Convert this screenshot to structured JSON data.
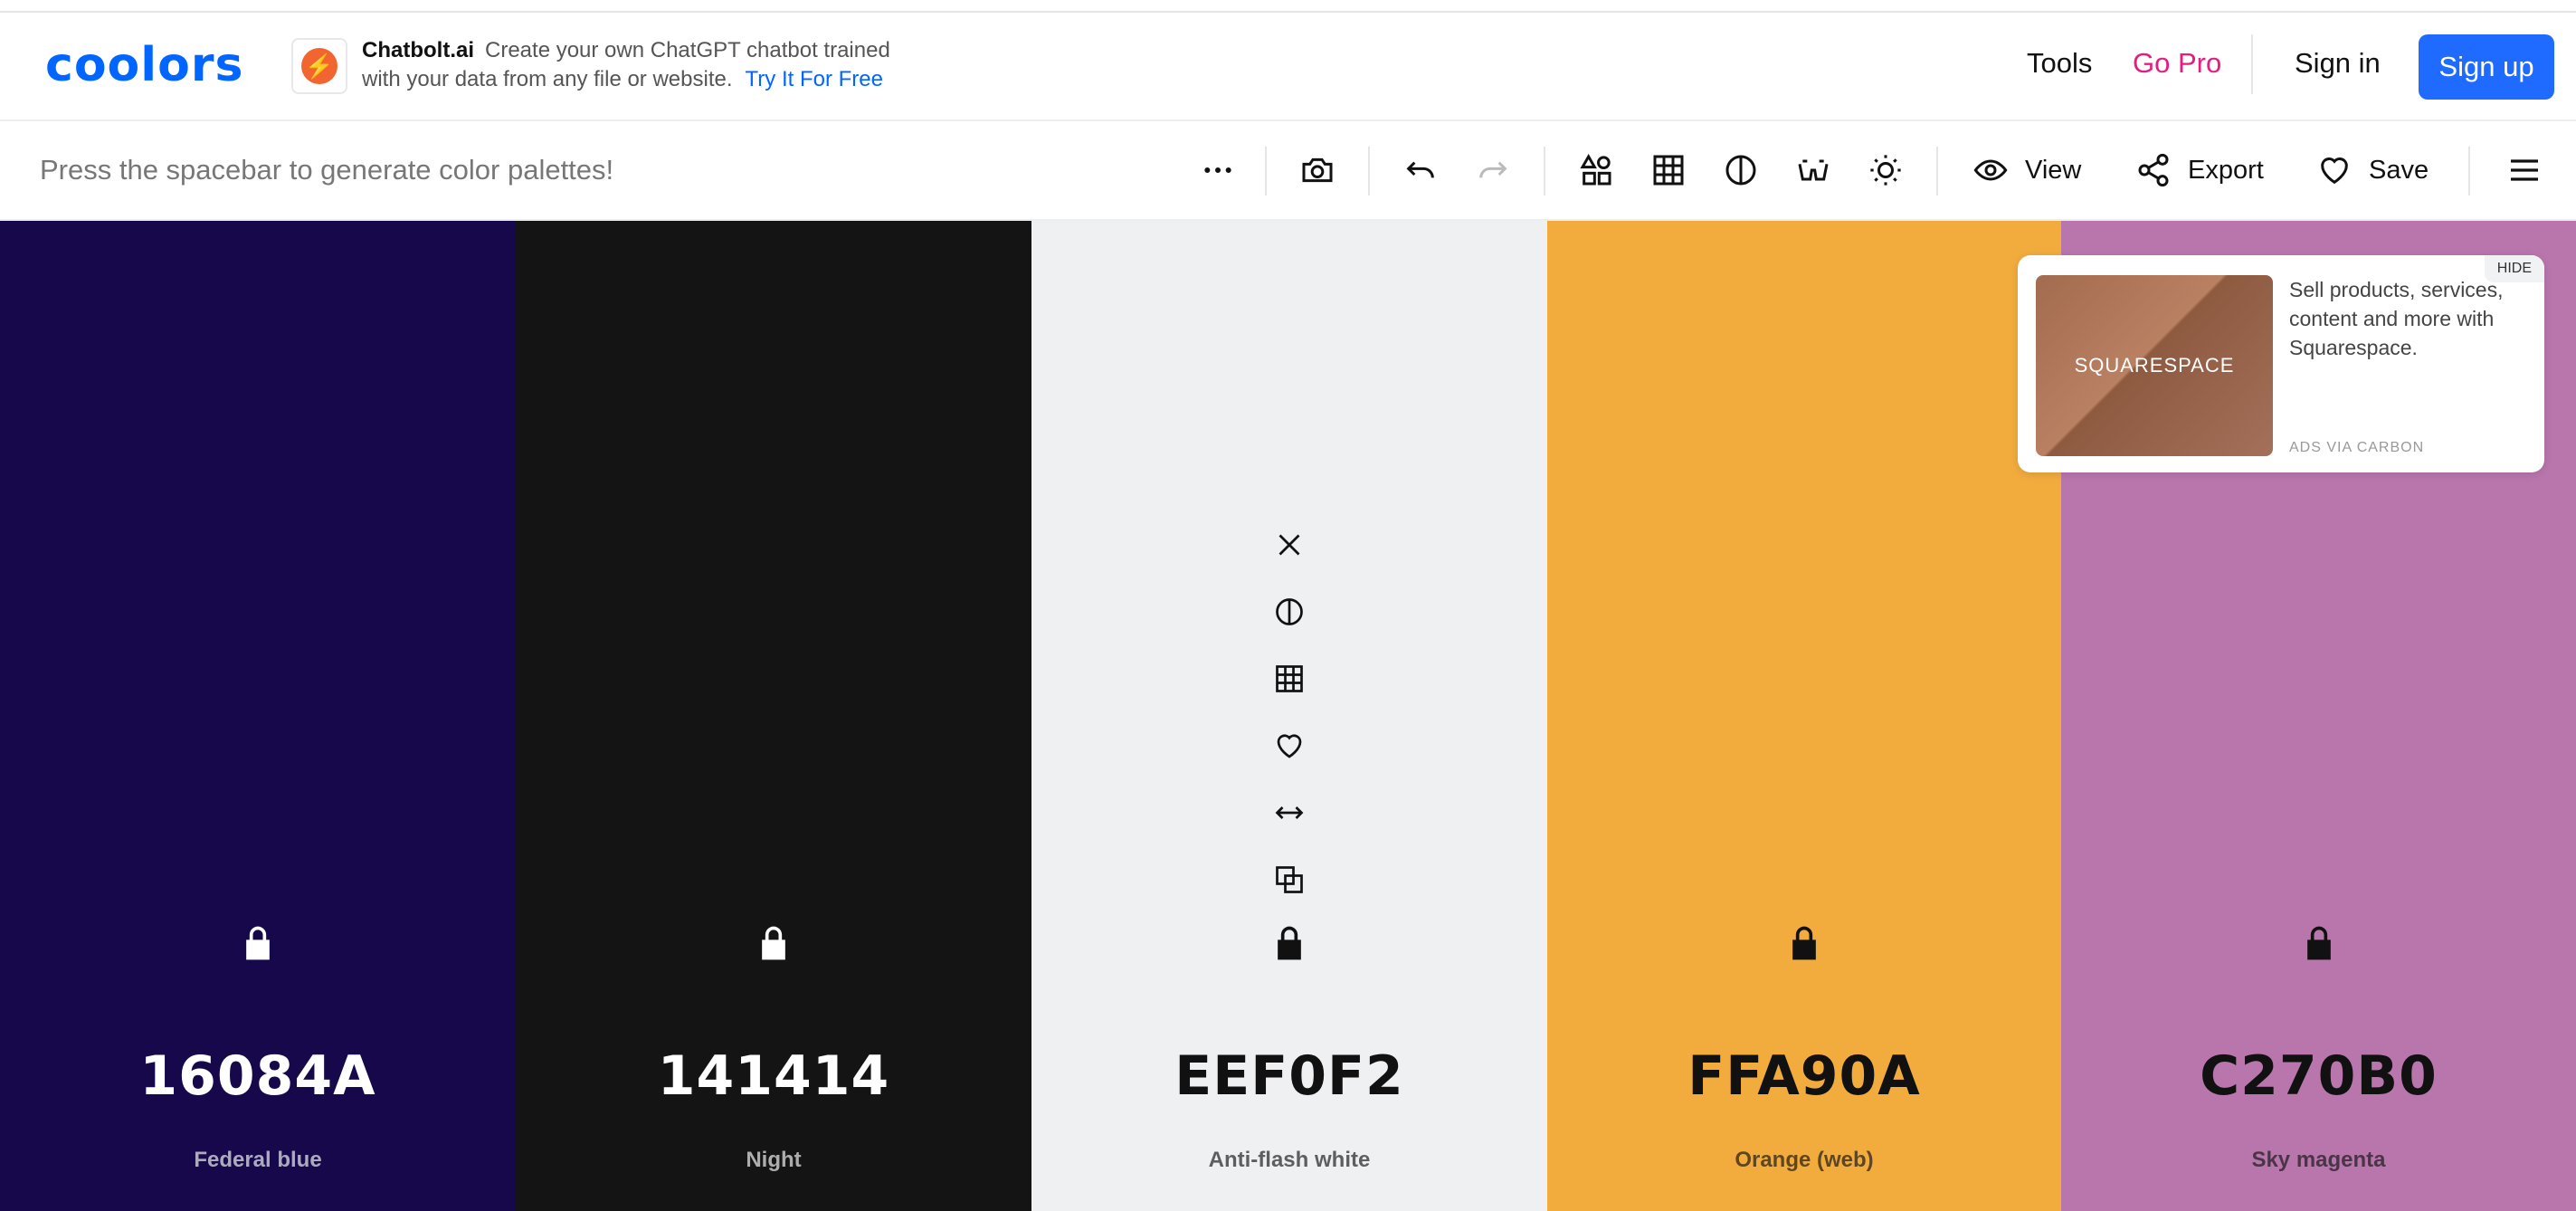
{
  "brand": {
    "logo": "coolors"
  },
  "ad_banner": {
    "title": "Chatbolt.ai",
    "line1": "Create your own ChatGPT chatbot trained",
    "line2": "with your data from any file or website.",
    "cta": "Try It For Free"
  },
  "nav": {
    "tools": "Tools",
    "gopro": "Go Pro",
    "signin": "Sign in",
    "signup": "Sign up"
  },
  "toolbar": {
    "hint": "Press the spacebar to generate color palettes!",
    "view": "View",
    "export": "Export",
    "save": "Save"
  },
  "palette": [
    {
      "hex": "16084A",
      "name": "Federal blue",
      "color": "#16084A",
      "text_color": "#ffffff"
    },
    {
      "hex": "141414",
      "name": "Night",
      "color": "#141414",
      "text_color": "#ffffff"
    },
    {
      "hex": "EEF0F2",
      "name": "Anti-flash white",
      "color": "#EEF0F2",
      "text_color": "#111111"
    },
    {
      "hex": "FFA90A",
      "name": "Orange (web)",
      "color": "#F2AC3E",
      "text_color": "#111111"
    },
    {
      "hex": "C270B0",
      "name": "Sky magenta",
      "color": "#B976AD",
      "text_color": "#111111"
    }
  ],
  "carbon_ad": {
    "image_label": "SQUARESPACE",
    "text": "Sell products, services, content and more with Squarespace.",
    "via": "ADS VIA CARBON",
    "hide": "HIDE"
  },
  "icons": {
    "toolbar": [
      "more-dots-icon",
      "camera-icon",
      "undo-icon",
      "redo-icon",
      "shapes-icon",
      "grid-icon",
      "contrast-icon",
      "glasses-icon",
      "sun-icon",
      "eye-icon",
      "share-icon",
      "heart-icon",
      "menu-icon"
    ],
    "swatch_tools": [
      "close-icon",
      "contrast-icon",
      "grid-icon",
      "heart-icon",
      "drag-arrows-icon",
      "copy-icon",
      "lock-icon"
    ]
  }
}
